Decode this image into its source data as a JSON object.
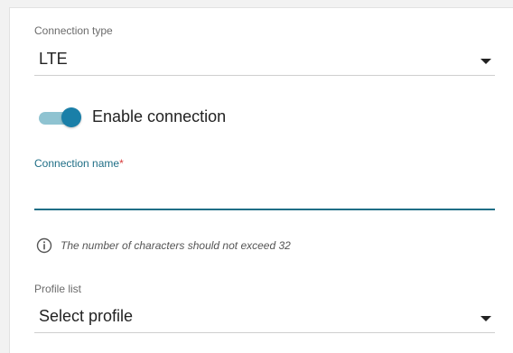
{
  "connection_type": {
    "label": "Connection type",
    "value": "LTE"
  },
  "enable_connection": {
    "label": "Enable connection",
    "enabled": true
  },
  "connection_name": {
    "label": "Connection name",
    "required_mark": "*",
    "value": ""
  },
  "hint": {
    "icon": "info-icon",
    "text": "The number of characters should not exceed 32"
  },
  "profile_list": {
    "label": "Profile list",
    "value": "Select profile"
  },
  "colors": {
    "accent": "#1a7fa8",
    "track": "#8fc3d1",
    "focus_underline": "#1f6e86",
    "required": "#d83a3a"
  }
}
